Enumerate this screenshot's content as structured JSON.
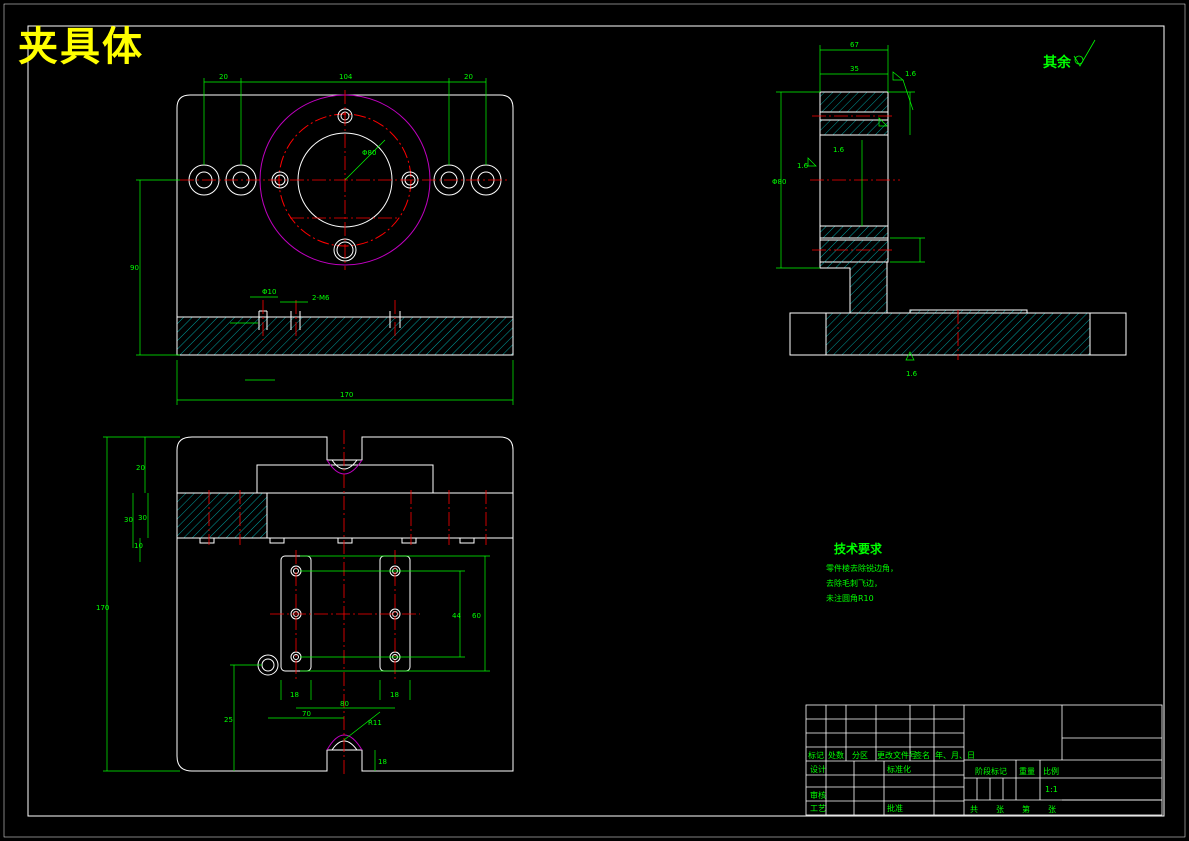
{
  "drawing": {
    "title": "夹具体",
    "surface_note": "其余",
    "technical_requirements": {
      "title": "技术要求",
      "lines": [
        "零件棱去除锐边角，",
        "去除毛刺飞边，",
        "未注圆角R10"
      ]
    }
  },
  "dimensions": {
    "top_view": {
      "width_total": "170",
      "span_top": "104",
      "left_offset": "20",
      "right_offset": "20",
      "height_hole": "90",
      "bore_dia": "Φ80",
      "hole_dia": "Φ10",
      "thread": "2-M6"
    },
    "front_view": {
      "height_total": "170",
      "h1": "20",
      "h2": "30",
      "h3": "10",
      "w1": "18",
      "w2": "18",
      "pitch": "44",
      "pitch2": "60",
      "base_w": "70",
      "base_w2": "80",
      "radius": "R11",
      "v1": "25",
      "v2": "18"
    },
    "side_view": {
      "w_total": "67",
      "w_inner": "35",
      "h_total": "Φ80",
      "roughness": "1.6"
    }
  },
  "title_block": {
    "header_row": [
      "标记",
      "处数",
      "分区",
      "更改文件号",
      "签名",
      "年、月、日"
    ],
    "left_rows": [
      "设计",
      "审核",
      "工艺"
    ],
    "standardize": "标准化",
    "approve": "批准",
    "stage_label": "阶段标记",
    "weight_label": "重量",
    "scale_label": "比例",
    "scale_value": "1:1",
    "sheet_info": [
      "共",
      "张",
      "第",
      "张"
    ]
  },
  "colors": {
    "background": "#000000",
    "outline": "#ffffff",
    "dimension": "#00ff00",
    "centerline": "#ff0000",
    "hatch": "#00c8c8",
    "phantom": "#c000c0",
    "title_text": "#ffff00"
  }
}
